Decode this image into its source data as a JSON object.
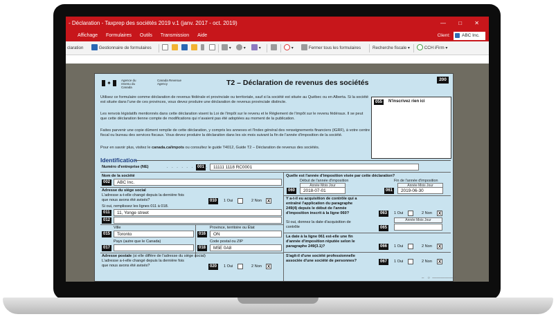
{
  "window": {
    "title": "- Déclaration - Taxprep des sociétés 2019 v.1 (janv. 2017 - oct. 2019)"
  },
  "menu": {
    "items": [
      "Affichage",
      "Formulaires",
      "Outils",
      "Transmission",
      "Aide"
    ],
    "client_label": "Client:",
    "client_value": "ABC Inc."
  },
  "toolbar": {
    "declaration": "claration",
    "forms_manager": "Gestionnaire de formulaires",
    "close_all": "Fermer tous les formulaires",
    "tax_search": "Recherche fiscale",
    "iform": "CCH iFirm"
  },
  "form": {
    "agency_fr": "Agence du revenu du Canada",
    "agency_en": "Canada Revenue Agency",
    "title": "T2 – Déclaration de revenus des sociétés",
    "number": "200",
    "para1": "Utilisez ce formulaire comme déclaration de revenus fédérale et provinciale ou territoriale, sauf si la société est située au Québec ou en Alberta. Si la société est située dans l'une de ces provinces, vous devez produire une déclaration de revenus provinciale distincte.",
    "para2": "Les renvois législatifs mentionnés dans cette déclaration visent la Loi de l'impôt sur le revenu et le Règlement de l'impôt sur le revenu fédéraux. Il se peut que cette déclaration tienne compte de modifications qui n'avaient pas été adoptées au moment de la publication.",
    "para3": "Faites parvenir une copie dûment remplie de cette déclaration, y compris les annexes et l'Index général des renseignements financiers (IGRF), à votre centre fiscal ou bureau des services fiscaux. Vous devez produire la déclaration dans les six mois suivant la fin de l'année d'imposition de la société.",
    "para4_a": "Pour en savoir plus, visitez le ",
    "para4_link": "canada.ca/impots",
    "para4_b": " ou consultez le guide T4012, Guide T2 – Déclaration de revenus des sociétés.",
    "note_code": "055",
    "note_label": "N'inscrivez rien ici",
    "section": "Identification",
    "ne_label": "Numéro d'entreprise (NE)",
    "ne_code": "001",
    "ne_value": "11111 1118 RC0001",
    "name_label": "Nom de la société",
    "name_code": "002",
    "name_value": "ABC Inc.",
    "hq_label": "Adresse du siège social",
    "hq_q1": "L'adresse a-t-elle changé depuis la dernière fois",
    "hq_q2": "que nous avons été avisés?",
    "hq_q_code": "010",
    "yes1": "1 Oui",
    "no2": "2 Non",
    "no_mark": "X",
    "hq_fill": "Si oui, remplissez les lignes 011 à 018.",
    "addr1_code": "011",
    "addr1_value": "11, Yonge street",
    "addr2_code": "012",
    "city_label": "Ville",
    "city_code": "015",
    "city_value": "Toronto",
    "prov_label": "Province, territoire ou État",
    "prov_code": "016",
    "prov_value": "ON",
    "country_label": "Pays (autre que le Canada)",
    "country_code": "017",
    "postal_label": "Code postal ou ZIP",
    "postal_code": "018",
    "postal_value": "M5E 0A8",
    "mail_label_bold": "Adresse postale",
    "mail_label_rest": " (si elle diffère de l'adresse du siège social)",
    "mail_q1": "L'adresse a-t-elle changé depuis la dernière fois",
    "mail_q2": "que nous avons été avisés?",
    "mail_q_code": "020",
    "year_q": "Quelle est l'année d'imposition visée par cette déclaration?",
    "start_label": "Début de l'année d'imposition",
    "end_label": "Fin de l'année d'imposition",
    "date_hdr": "Année Mois Jour",
    "start_code": "060",
    "start_value": "2018-07-01",
    "end_code": "061",
    "end_value": "2019-06-30",
    "ctrl_q1": "Y a-t-il eu acquisition de contrôle qui a",
    "ctrl_q2": "entraîné l'application du paragraphe",
    "ctrl_q3": "249(4) depuis le début de l'année",
    "ctrl_q4": "d'imposition inscrit à la ligne 060?",
    "ctrl_code": "063",
    "ctrl_date_1": "Si oui, donnez la date d'acquisition de",
    "ctrl_date_2": "contrôle",
    "ctrl_date_code": "065",
    "date61_q1": "La date à la ligne 061 est-elle une fin",
    "date61_q2": "d'année d'imposition réputée selon le",
    "date61_q3": "paragraphe 249(3.1)?",
    "date61_code": "066",
    "prof_q1": "S'agit-il d'une société professionnelle",
    "prof_q2": "associée d'une société de personnes?",
    "prof_code": "067"
  }
}
